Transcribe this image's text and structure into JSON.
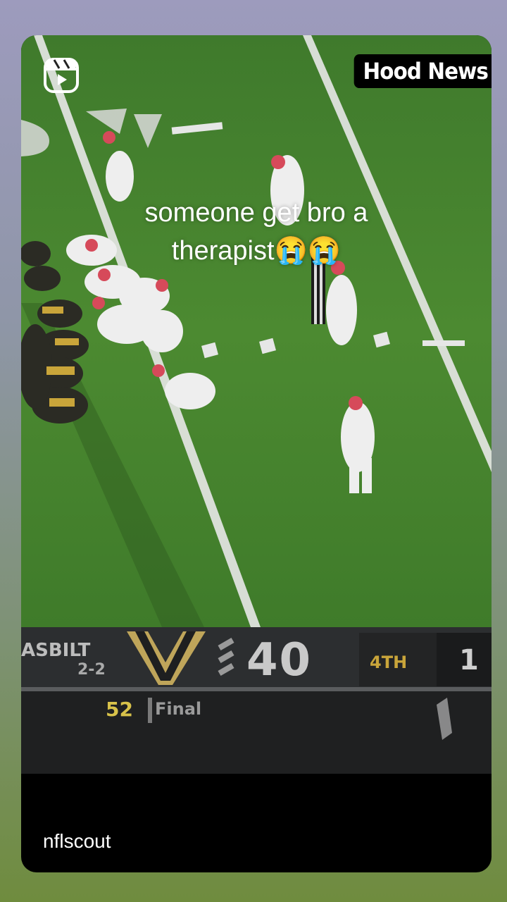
{
  "watermark": "Hood News",
  "caption": {
    "line1": "someone get bro a",
    "line2": "therapist😭😭"
  },
  "author": {
    "handle": "nflscout"
  },
  "scoreboard": {
    "team": "ASBILT",
    "record": "2-2",
    "score": "40",
    "quarter": "4TH",
    "right_score": "1",
    "clock": "52",
    "status": "Final"
  },
  "icons": {
    "reel": "reels-icon"
  },
  "colors": {
    "field": "#4e8a2e",
    "jersey_home": "#f2f2f2",
    "jersey_away": "#2a2a22",
    "accent_gold": "#c9a53a"
  }
}
